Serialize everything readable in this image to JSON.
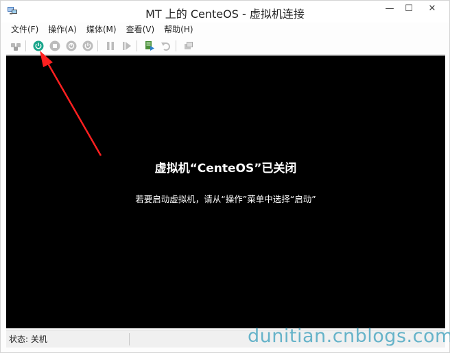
{
  "window": {
    "title": "MT 上的 CenteOS - 虚拟机连接",
    "controls": {
      "minimize": "—",
      "maximize": "☐",
      "close": "✕"
    }
  },
  "menu": {
    "items": [
      {
        "label": "文件(F)"
      },
      {
        "label": "操作(A)"
      },
      {
        "label": "媒体(M)"
      },
      {
        "label": "查看(V)"
      },
      {
        "label": "帮助(H)"
      }
    ]
  },
  "toolbar": {
    "icons": [
      "ctrl-alt-del-icon",
      "start-icon",
      "turn-off-icon",
      "shutdown-icon",
      "save-icon",
      "pause-icon",
      "resume-icon",
      "snapshot-icon",
      "revert-icon",
      "share-icon"
    ],
    "start_color": "#1aa58b"
  },
  "screen": {
    "title": "虚拟机“CenteOS”已关闭",
    "subtitle": "若要启动虚拟机，请从“操作”菜单中选择“启动”"
  },
  "status": {
    "text": "状态: 关机"
  },
  "watermark": "dunitian.cnblogs.com",
  "colors": {
    "arrow": "#ff2020",
    "screen_bg": "#000000",
    "watermark": "#66b3c9"
  }
}
